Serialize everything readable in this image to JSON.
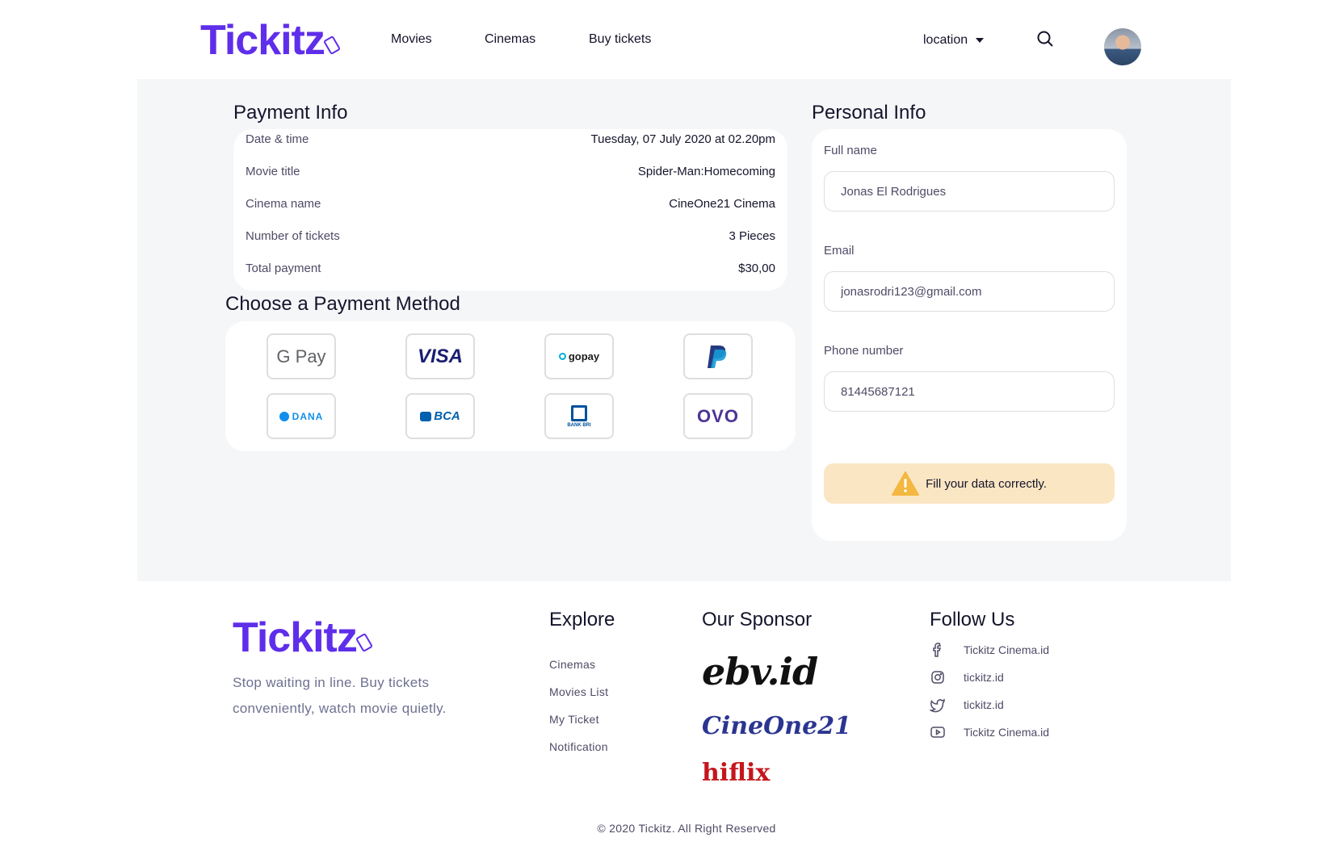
{
  "header": {
    "logo": "Tickitz",
    "nav": [
      "Movies",
      "Cinemas",
      "Buy tickets"
    ],
    "location_label": "location"
  },
  "payment_info": {
    "title": "Payment Info",
    "rows": [
      {
        "label": "Date & time",
        "value": "Tuesday, 07 July 2020 at 02.20pm"
      },
      {
        "label": "Movie title",
        "value": "Spider-Man:Homecoming"
      },
      {
        "label": "Cinema name",
        "value": "CineOne21 Cinema"
      },
      {
        "label": "Number of tickets",
        "value": "3 Pieces"
      },
      {
        "label": "Total payment",
        "value": "$30,00"
      }
    ]
  },
  "payment_method": {
    "title": "Choose a Payment Method",
    "methods": [
      "G Pay",
      "VISA",
      "gopay",
      "PayPal",
      "DANA",
      "BCA",
      "BANK BRI",
      "OVO"
    ]
  },
  "personal_info": {
    "title": "Personal Info",
    "full_name_label": "Full name",
    "full_name_value": "Jonas El Rodrigues",
    "email_label": "Email",
    "email_value": "jonasrodri123@gmail.com",
    "phone_label": "Phone number",
    "phone_value": "81445687121",
    "warning": "Fill your data correctly."
  },
  "footer": {
    "logo": "Tickitz",
    "tagline": "Stop waiting in line. Buy tickets conveniently, watch movie quietly.",
    "explore_title": "Explore",
    "explore_links": [
      "Cinemas",
      "Movies List",
      "My Ticket",
      "Notification"
    ],
    "sponsor_title": "Our Sponsor",
    "sponsors": [
      "ebv.id",
      "CineOne21",
      "hiflix"
    ],
    "follow_title": "Follow Us",
    "follow": [
      {
        "icon": "facebook-icon",
        "label": "Tickitz Cinema.id"
      },
      {
        "icon": "instagram-icon",
        "label": "tickitz.id"
      },
      {
        "icon": "twitter-icon",
        "label": "tickitz.id"
      },
      {
        "icon": "youtube-icon",
        "label": "Tickitz Cinema.id"
      }
    ],
    "copyright": "© 2020 Tickitz. All Right Reserved"
  },
  "colors": {
    "brand": "#5f2eea",
    "background": "#f5f6f8",
    "warning_bg": "#fbe6c3"
  }
}
